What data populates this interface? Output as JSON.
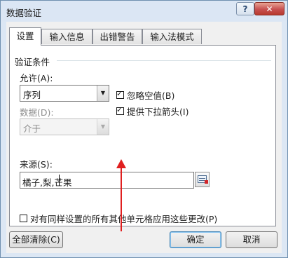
{
  "window": {
    "title": "数据验证",
    "help_glyph": "?",
    "close_glyph": "✕"
  },
  "tabs": [
    {
      "label": "设置",
      "active": true
    },
    {
      "label": "输入信息",
      "active": false
    },
    {
      "label": "出错警告",
      "active": false
    },
    {
      "label": "输入法模式",
      "active": false
    }
  ],
  "validation": {
    "legend": "验证条件",
    "allow_label": "允许(A):",
    "allow_value": "序列",
    "data_label": "数据(D):",
    "data_value": "介于",
    "ignore_blank_label": "忽略空值(B)",
    "ignore_blank_checked": true,
    "dropdown_label": "提供下拉箭头(I)",
    "dropdown_checked": true,
    "source_label": "来源(S):",
    "source_value": "橘子,梨,芒果"
  },
  "apply_all": {
    "label": "对有同样设置的所有其他单元格应用这些更改(P)",
    "checked": false
  },
  "buttons": {
    "clear_all": "全部清除(C)",
    "ok": "确定",
    "cancel": "取消"
  },
  "icons": {
    "checkmark": "✓",
    "dropdown": "▼",
    "ref_picker": "range-select-icon"
  },
  "colors": {
    "annotation": "#e01f1f",
    "title_bar": "#dbe6f4",
    "close_button": "#c75050"
  }
}
